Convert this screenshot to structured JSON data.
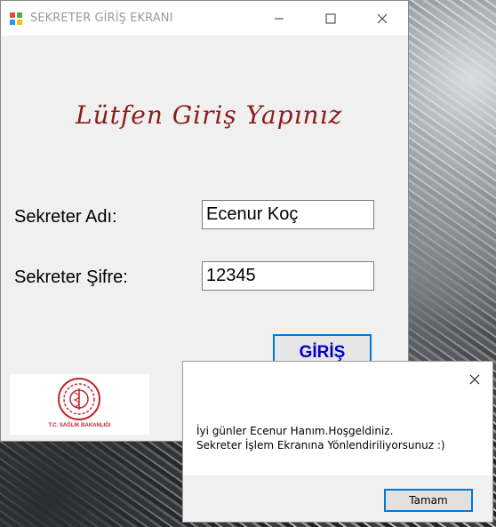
{
  "desktop": {
    "name": "desktop-wallpaper"
  },
  "window": {
    "title": "SEKRETER GİRİŞ EKRANI",
    "heading": "Lütfen Giriş Yapınız",
    "username_label": "Sekreter Adı:",
    "username_value": "Ecenur Koç",
    "password_label": "Sekreter Şifre:",
    "password_value": "12345",
    "login_button": "GİRİŞ",
    "logo_caption": "T.C. SAĞLIK BAKANLIĞI"
  },
  "dialog": {
    "line1": "İyi günler Ecenur Hanım.Hoşgeldiniz.",
    "line2": "Sekreter İşlem Ekranına Yönlendiriliyorsunuz :)",
    "ok_button": "Tamam"
  },
  "colors": {
    "heading": "#8b1d1d",
    "login_text": "#0000cc",
    "focus_border": "#0078d7",
    "logo_red": "#c0272d"
  }
}
